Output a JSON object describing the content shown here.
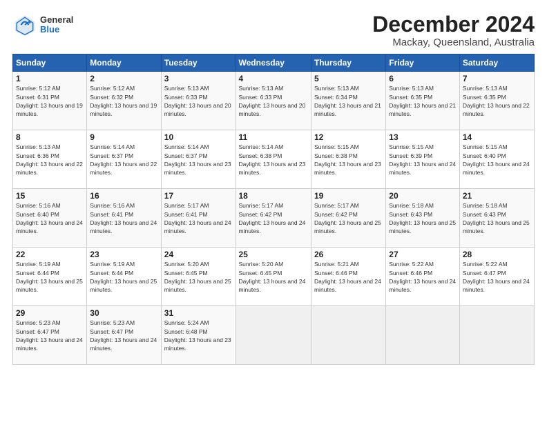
{
  "header": {
    "logo": {
      "general": "General",
      "blue": "Blue"
    },
    "title": "December 2024",
    "subtitle": "Mackay, Queensland, Australia"
  },
  "calendar": {
    "days_of_week": [
      "Sunday",
      "Monday",
      "Tuesday",
      "Wednesday",
      "Thursday",
      "Friday",
      "Saturday"
    ],
    "weeks": [
      [
        {
          "day": "",
          "empty": true
        },
        {
          "day": "",
          "empty": true
        },
        {
          "day": "",
          "empty": true
        },
        {
          "day": "",
          "empty": true
        },
        {
          "day": "",
          "empty": true
        },
        {
          "day": "",
          "empty": true
        },
        {
          "day": "",
          "empty": true
        }
      ],
      [
        {
          "day": "1",
          "sunrise": "5:12 AM",
          "sunset": "6:31 PM",
          "daylight": "13 hours and 19 minutes."
        },
        {
          "day": "2",
          "sunrise": "5:12 AM",
          "sunset": "6:32 PM",
          "daylight": "13 hours and 19 minutes."
        },
        {
          "day": "3",
          "sunrise": "5:13 AM",
          "sunset": "6:33 PM",
          "daylight": "13 hours and 20 minutes."
        },
        {
          "day": "4",
          "sunrise": "5:13 AM",
          "sunset": "6:33 PM",
          "daylight": "13 hours and 20 minutes."
        },
        {
          "day": "5",
          "sunrise": "5:13 AM",
          "sunset": "6:34 PM",
          "daylight": "13 hours and 21 minutes."
        },
        {
          "day": "6",
          "sunrise": "5:13 AM",
          "sunset": "6:35 PM",
          "daylight": "13 hours and 21 minutes."
        },
        {
          "day": "7",
          "sunrise": "5:13 AM",
          "sunset": "6:35 PM",
          "daylight": "13 hours and 22 minutes."
        }
      ],
      [
        {
          "day": "8",
          "sunrise": "5:13 AM",
          "sunset": "6:36 PM",
          "daylight": "13 hours and 22 minutes."
        },
        {
          "day": "9",
          "sunrise": "5:14 AM",
          "sunset": "6:37 PM",
          "daylight": "13 hours and 22 minutes."
        },
        {
          "day": "10",
          "sunrise": "5:14 AM",
          "sunset": "6:37 PM",
          "daylight": "13 hours and 23 minutes."
        },
        {
          "day": "11",
          "sunrise": "5:14 AM",
          "sunset": "6:38 PM",
          "daylight": "13 hours and 23 minutes."
        },
        {
          "day": "12",
          "sunrise": "5:15 AM",
          "sunset": "6:38 PM",
          "daylight": "13 hours and 23 minutes."
        },
        {
          "day": "13",
          "sunrise": "5:15 AM",
          "sunset": "6:39 PM",
          "daylight": "13 hours and 24 minutes."
        },
        {
          "day": "14",
          "sunrise": "5:15 AM",
          "sunset": "6:40 PM",
          "daylight": "13 hours and 24 minutes."
        }
      ],
      [
        {
          "day": "15",
          "sunrise": "5:16 AM",
          "sunset": "6:40 PM",
          "daylight": "13 hours and 24 minutes."
        },
        {
          "day": "16",
          "sunrise": "5:16 AM",
          "sunset": "6:41 PM",
          "daylight": "13 hours and 24 minutes."
        },
        {
          "day": "17",
          "sunrise": "5:17 AM",
          "sunset": "6:41 PM",
          "daylight": "13 hours and 24 minutes."
        },
        {
          "day": "18",
          "sunrise": "5:17 AM",
          "sunset": "6:42 PM",
          "daylight": "13 hours and 24 minutes."
        },
        {
          "day": "19",
          "sunrise": "5:17 AM",
          "sunset": "6:42 PM",
          "daylight": "13 hours and 25 minutes."
        },
        {
          "day": "20",
          "sunrise": "5:18 AM",
          "sunset": "6:43 PM",
          "daylight": "13 hours and 25 minutes."
        },
        {
          "day": "21",
          "sunrise": "5:18 AM",
          "sunset": "6:43 PM",
          "daylight": "13 hours and 25 minutes."
        }
      ],
      [
        {
          "day": "22",
          "sunrise": "5:19 AM",
          "sunset": "6:44 PM",
          "daylight": "13 hours and 25 minutes."
        },
        {
          "day": "23",
          "sunrise": "5:19 AM",
          "sunset": "6:44 PM",
          "daylight": "13 hours and 25 minutes."
        },
        {
          "day": "24",
          "sunrise": "5:20 AM",
          "sunset": "6:45 PM",
          "daylight": "13 hours and 25 minutes."
        },
        {
          "day": "25",
          "sunrise": "5:20 AM",
          "sunset": "6:45 PM",
          "daylight": "13 hours and 24 minutes."
        },
        {
          "day": "26",
          "sunrise": "5:21 AM",
          "sunset": "6:46 PM",
          "daylight": "13 hours and 24 minutes."
        },
        {
          "day": "27",
          "sunrise": "5:22 AM",
          "sunset": "6:46 PM",
          "daylight": "13 hours and 24 minutes."
        },
        {
          "day": "28",
          "sunrise": "5:22 AM",
          "sunset": "6:47 PM",
          "daylight": "13 hours and 24 minutes."
        }
      ],
      [
        {
          "day": "29",
          "sunrise": "5:23 AM",
          "sunset": "6:47 PM",
          "daylight": "13 hours and 24 minutes."
        },
        {
          "day": "30",
          "sunrise": "5:23 AM",
          "sunset": "6:47 PM",
          "daylight": "13 hours and 24 minutes."
        },
        {
          "day": "31",
          "sunrise": "5:24 AM",
          "sunset": "6:48 PM",
          "daylight": "13 hours and 23 minutes."
        },
        {
          "day": "",
          "empty": true
        },
        {
          "day": "",
          "empty": true
        },
        {
          "day": "",
          "empty": true
        },
        {
          "day": "",
          "empty": true
        }
      ]
    ]
  }
}
